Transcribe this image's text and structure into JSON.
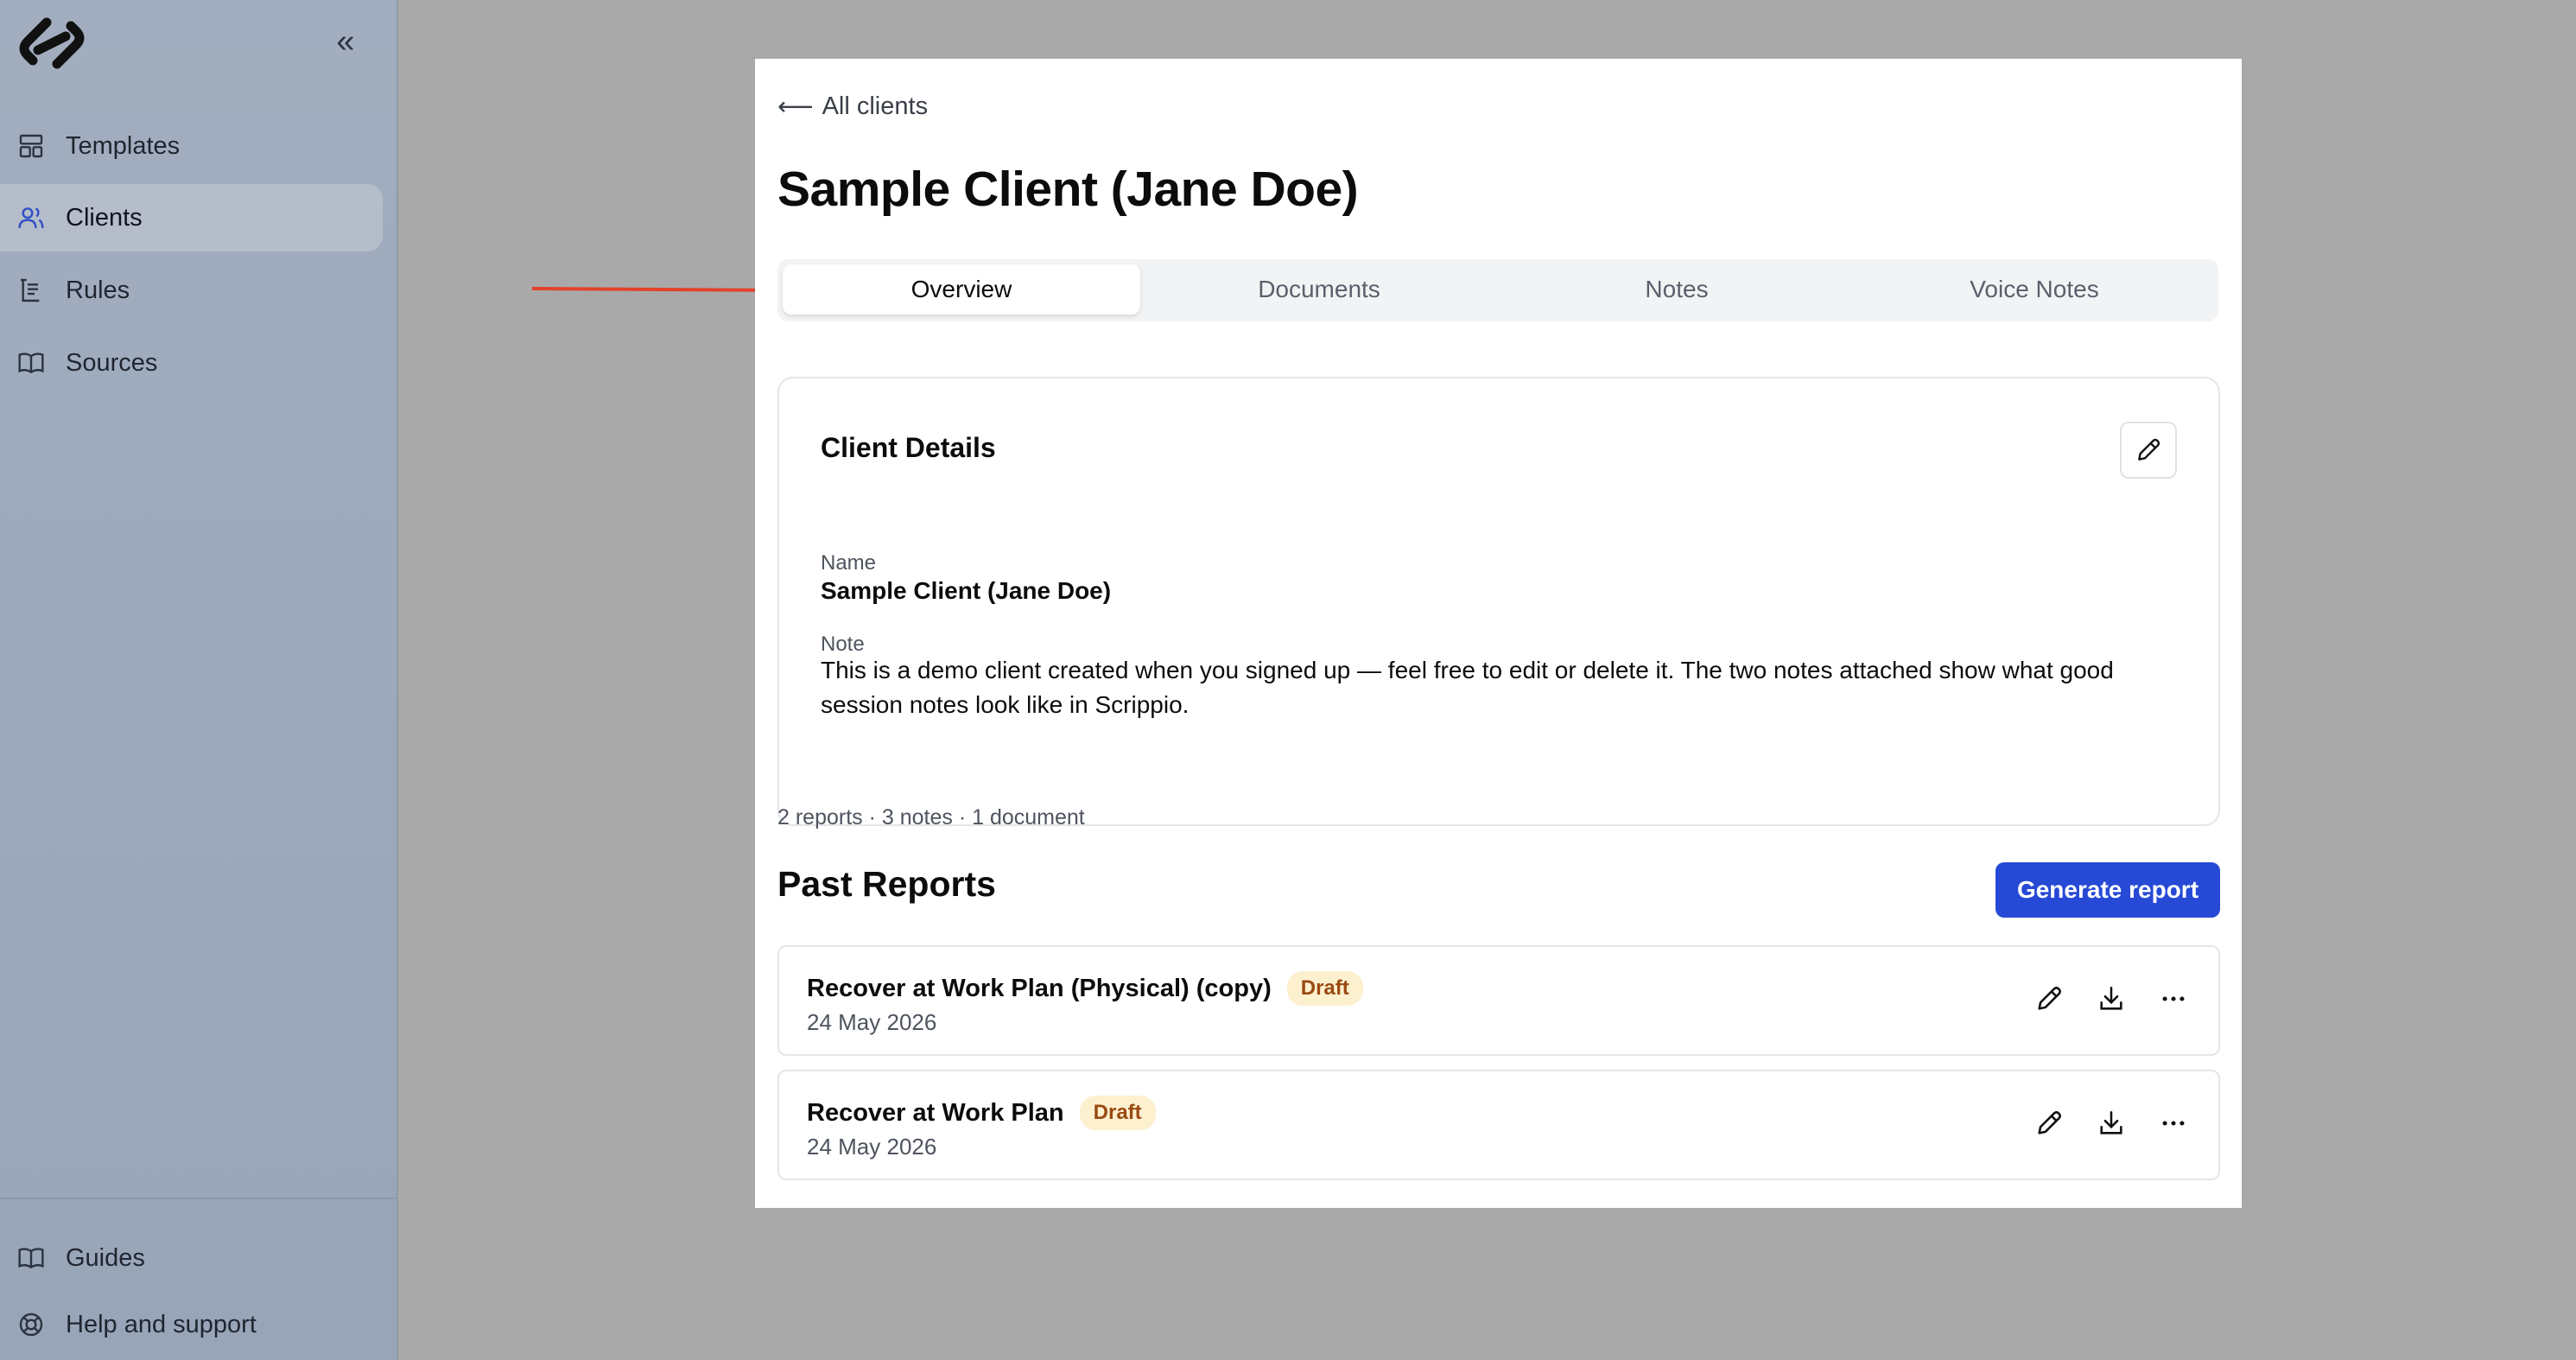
{
  "sidebar": {
    "collapse_glyph": "«",
    "items": [
      {
        "label": "Templates",
        "icon": "templates-icon",
        "active": false
      },
      {
        "label": "Clients",
        "icon": "users-icon",
        "active": true
      },
      {
        "label": "Rules",
        "icon": "rules-icon",
        "active": false
      },
      {
        "label": "Sources",
        "icon": "book-icon",
        "active": false
      }
    ],
    "footer_items": [
      {
        "label": "Guides",
        "icon": "book-open-icon"
      },
      {
        "label": "Help and support",
        "icon": "lifebuoy-icon"
      }
    ]
  },
  "page": {
    "back_label": "All clients",
    "title": "Sample Client (Jane Doe)"
  },
  "tabs": [
    {
      "label": "Overview",
      "active": true
    },
    {
      "label": "Documents",
      "active": false
    },
    {
      "label": "Notes",
      "active": false
    },
    {
      "label": "Voice Notes",
      "active": false
    }
  ],
  "client_details": {
    "title": "Client Details",
    "name_label": "Name",
    "name_value": "Sample Client (Jane Doe)",
    "note_label": "Note",
    "note_value": "This is a demo client created when you signed up — feel free to edit or delete it. The two notes attached show what good session notes look like in Scrippio."
  },
  "summary": "2 reports · 3 notes · 1 document",
  "past_reports": {
    "title": "Past Reports",
    "generate_label": "Generate report",
    "items": [
      {
        "title": "Recover at Work Plan (Physical) (copy)",
        "status": "Draft",
        "date": "24 May 2026"
      },
      {
        "title": "Recover at Work Plan",
        "status": "Draft",
        "date": "24 May 2026"
      }
    ]
  },
  "colors": {
    "accent": "#2649d6",
    "draft_badge_bg": "#fdf0cf",
    "draft_badge_text": "#9a4a12",
    "annotation_arrow": "#e2432a",
    "active_nav_icon": "#2f4fc7"
  }
}
